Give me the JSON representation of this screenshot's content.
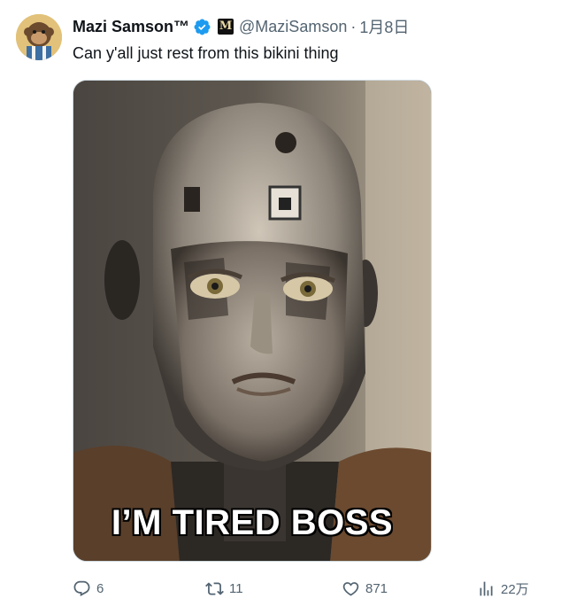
{
  "tweet": {
    "author": {
      "display_name": "Mazi Samson™",
      "handle": "@MaziSamson",
      "verified": true,
      "affiliate_badge_letter": "M",
      "avatar_icon": "monkey-avatar"
    },
    "separator": "·",
    "time": "1月8日",
    "text": "Can y'all just rest from this bikini thing",
    "media": {
      "caption": "I’M TIRED BOSS",
      "image_subject": "robot-face-image"
    },
    "actions": {
      "reply": {
        "icon": "reply-icon",
        "count": "6"
      },
      "retweet": {
        "icon": "retweet-icon",
        "count": "11"
      },
      "like": {
        "icon": "heart-icon",
        "count": "871"
      },
      "views": {
        "icon": "views-icon",
        "count": "22万"
      }
    }
  },
  "colors": {
    "text_primary": "#0f1419",
    "text_secondary": "#536471",
    "verified_blue": "#1d9bf0",
    "border": "#cfd9de"
  }
}
